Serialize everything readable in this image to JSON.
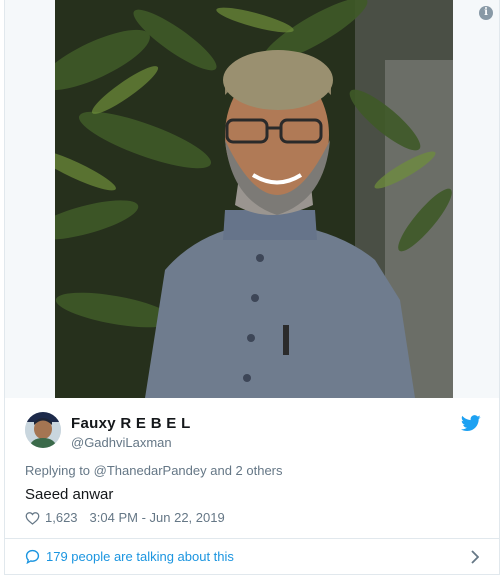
{
  "tweet": {
    "display_name": "Fauxy R E B E L",
    "handle": "@GadhviLaxman",
    "reply_prefix": "Replying to",
    "reply_mention": "@ThanedarPandey",
    "reply_suffix": "and 2 others",
    "text": "Saeed anwar",
    "likes": "1,623",
    "time": "3:04 PM - Jun 22, 2019",
    "talking": "179 people are talking about this"
  },
  "icons": {
    "info": "info-icon",
    "bird": "twitter-bird-icon",
    "heart": "heart-icon",
    "bubble": "comment-bubble-icon",
    "chevron": "chevron-right-icon"
  },
  "colors": {
    "link": "#1b95e0",
    "muted": "#657786",
    "text": "#14171a",
    "border": "#e1e8ed"
  }
}
